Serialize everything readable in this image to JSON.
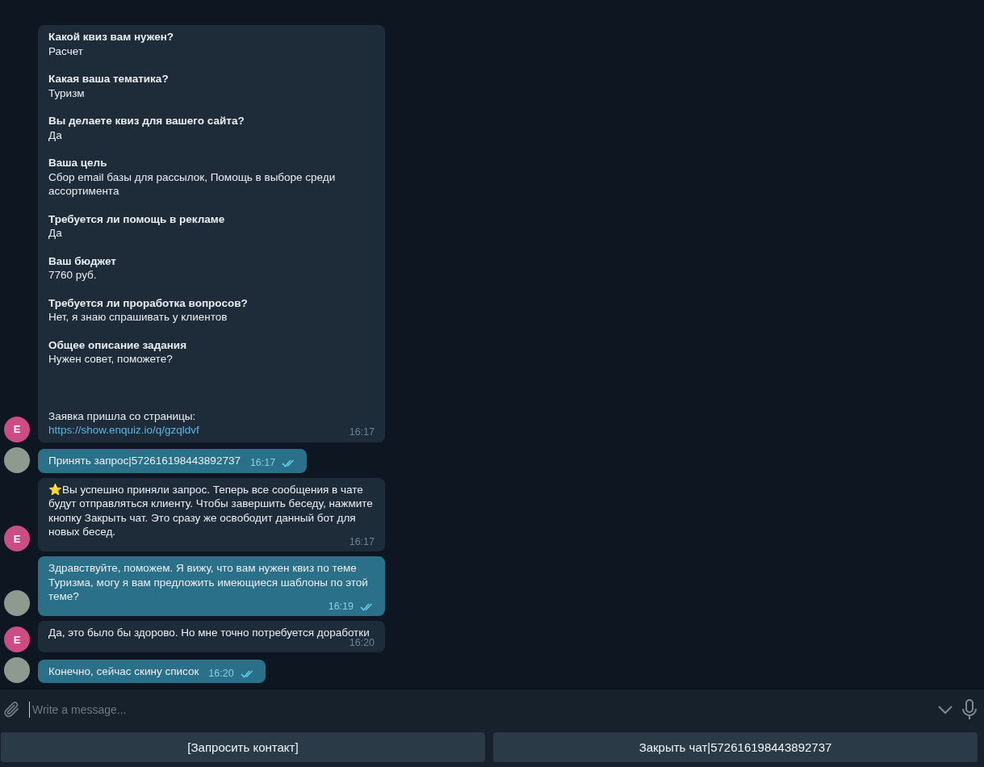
{
  "messages": [
    {
      "kind": "form",
      "outgoing": false,
      "initial": "E",
      "fields": [
        {
          "question": "Какой квиз вам нужен?",
          "answer": "Расчет"
        },
        {
          "question": "Какая ваша тематика?",
          "answer": "Туризм"
        },
        {
          "question": "Вы делаете квиз для вашего сайта?",
          "answer": "Да"
        },
        {
          "question": "Ваша цель",
          "answer": "Сбор email базы для рассылок, Помощь в выборе среди ассортимента"
        },
        {
          "question": "Требуется ли помощь в рекламе",
          "answer": "Да"
        },
        {
          "question": "Ваш бюджет",
          "answer": "7760 руб."
        },
        {
          "question": "Требуется ли проработка вопросов?",
          "answer": "Нет, я знаю спрашивать у клиентов"
        },
        {
          "question": "Общее описание задания",
          "answer": "Нужен совет, поможете?"
        }
      ],
      "note": "Заявка пришла со страницы:",
      "link": "https://show.enquiz.io/q/gzqldvf",
      "time": "16:17"
    },
    {
      "kind": "text",
      "outgoing": true,
      "text": "Принять запрос|572616198443892737",
      "time": "16:17",
      "read": true
    },
    {
      "kind": "text",
      "outgoing": false,
      "initial": "E",
      "text": "⭐Вы успешно приняли запрос. Теперь все сообщения в чате будут отправляться клиенту. Чтобы завершить беседу, нажмите кнопку Закрыть чат. Это сразу же освободит данный бот для новых бесед.",
      "time": "16:17"
    },
    {
      "kind": "text",
      "outgoing": true,
      "text": "Здравствуйте, поможем. Я вижу, что вам нужен квиз по теме Туризма, могу я вам предложить имеющиеся шаблоны по этой теме?",
      "time": "16:19",
      "read": true
    },
    {
      "kind": "text",
      "outgoing": false,
      "initial": "E",
      "text": "Да, это было бы здорово. Но мне точно потребуется доработки",
      "time": "16:20"
    },
    {
      "kind": "text",
      "outgoing": true,
      "text": "Конечно, сейчас скину список",
      "time": "16:20",
      "read": true
    }
  ],
  "composer": {
    "placeholder": "Write a message..."
  },
  "keyboard": [
    {
      "label": "[Запросить контакт]"
    },
    {
      "label": "Закрыть чат|572616198443892737"
    }
  ]
}
